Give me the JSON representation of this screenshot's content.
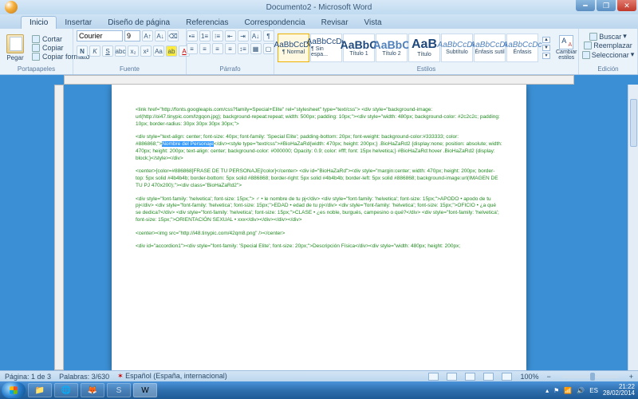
{
  "window": {
    "title": "Documento2 - Microsoft Word"
  },
  "tabs": {
    "t0": "Inicio",
    "t1": "Insertar",
    "t2": "Diseño de página",
    "t3": "Referencias",
    "t4": "Correspondencia",
    "t5": "Revisar",
    "t6": "Vista"
  },
  "clipboard": {
    "paste": "Pegar",
    "cut": "Cortar",
    "copy": "Copiar",
    "format": "Copiar formato",
    "label": "Portapapeles"
  },
  "font": {
    "name": "Courier",
    "size": "9",
    "label": "Fuente"
  },
  "para": {
    "label": "Párrafo"
  },
  "styles": {
    "tiles": {
      "s0": "¶ Normal",
      "s1": "¶ Sin espa...",
      "s2": "Título 1",
      "s3": "Título 2",
      "s4": "Título",
      "s5": "Subtítulo",
      "s6": "Énfasis sutil",
      "s7": "Énfasis"
    },
    "preview": "AaBbCcDc",
    "preview_big": "AaBbC",
    "preview_aab": "AaB",
    "change": "Cambiar estilos",
    "label": "Estilos"
  },
  "editing": {
    "find": "Buscar",
    "replace": "Reemplazar",
    "select": "Seleccionar",
    "label": "Edición"
  },
  "status": {
    "page": "Página: 1 de 3",
    "words": "Palabras: 3/630",
    "lang": "Español (España, internacional)",
    "zoom": "100%"
  },
  "tray": {
    "lang": "ES",
    "time": "21:22",
    "date": "28/02/2014"
  },
  "doc": {
    "p1": "<link href=\"http://fonts.googleapis.com/css?family=Special+Elite\" rel=\"stylesheet\" type=\"text/css\">\n<div style=\"background-image: url(http://oi47.tinypic.com/lzgqon.jpg); background-repeat:repeat; width: 500px; padding: 10px;\"><div style=\"width: 480px; background-color: #2c2c2c; padding: 10px; border-radius: 30px 30px 30px 30px;\">",
    "p2a": "<div style=\"text-align: center; font-size: 40px; font-family: 'Special Elite'; padding-bottom: 20px; font-weight: background-color:#333333; color: #886868;\">",
    "p2sel": "Nombre del Personaje",
    "p2b": "</div><style type=\"text/css\">#BioHaZaRd{width: 470px; height: 200px;} .BioHaZaRd2 {display:none; position: absolute; width: 470px; height: 200px; text-align: center; background-color: #000000; Opacity: 0.9; color: #fff; font: 15px helvetica;} #BioHaZaRd:hover .BioHaZaRd2 {display: block;}</style></div>",
    "p3": "<center>[color=#886868]FRASE DE TU PERSONAJE[/color]</center>\n<div id=\"BioHaZaRd\"><div style=\"margin:center; width: 470px; height: 200px; border-top: 5px solid #4b4b4b; border-bottom: 5px solid #886868; border-right: 5px solid #4b4b4b; border-left: 5px solid #886868; background-image:url(IMAGEN DE TU PJ 470x200);\"><div class=\"BioHaZaRd2\">",
    "p4": "<div style=\"font-family: 'helvetica'; font-size: 15px;\">          ♂ • le nombre de tu pj</div>\n<div style=\"font-family: 'helvetica'; font-size: 15px;\">APODO • apodo de tu pj</div>\n<div style=\"font-family: 'helvetica'; font-size: 15px;\">EDAD • edad de tu pj</div>\n<div style=\"font-family: 'helvetica'; font-size: 15px;\">OFICIO • ¿a qué se dedica?</div>\n<div style=\"font-family: 'helvetica'; font-size: 15px;\">CLASE • ¿es noble, burgués, campesino o qué?</div>\n<div style=\"font-family: 'helvetica'; font-size: 15px;\">ORIENTACIÓN SEXUAL • xxx</div></div></div></div>",
    "p5": "<center><img src=\"http://i48.tinypic.com/42qm8.png\" /></center>",
    "p6": "<div id=\"accordion1\"><div style=\"font-family: 'Special Elite'; font-size: 20px;\">Descripción Física</div><div style=\"width: 480px; height: 200px;"
  }
}
